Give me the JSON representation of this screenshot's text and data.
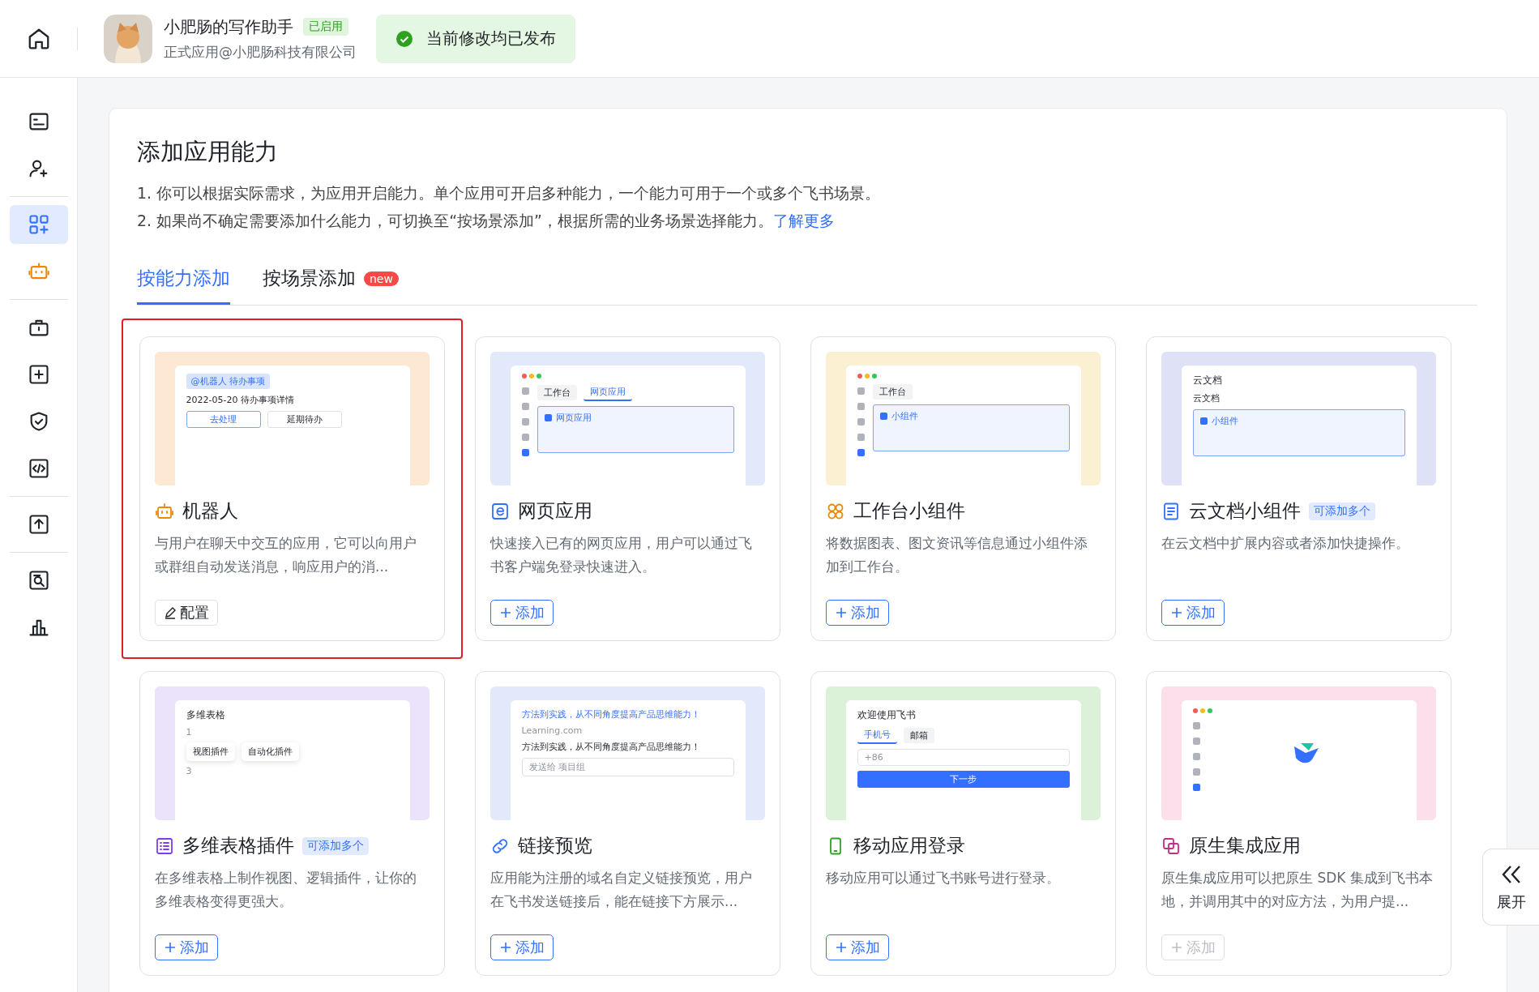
{
  "app": {
    "name": "小肥肠的写作助手",
    "status_badge": "已启用",
    "subtitle": "正式应用@小肥肠科技有限公司",
    "publish_status": "当前修改均已发布"
  },
  "sidebar": {
    "groups": [
      [
        {
          "selected": false
        },
        {
          "selected": false
        }
      ],
      [
        {
          "selected": true
        },
        {
          "selected": false
        }
      ],
      [
        {
          "selected": false
        },
        {
          "selected": false
        },
        {
          "selected": false
        },
        {
          "selected": false
        }
      ],
      [
        {
          "selected": false
        }
      ],
      [
        {
          "selected": false
        },
        {
          "selected": false
        }
      ]
    ]
  },
  "page": {
    "title": "添加应用能力",
    "notes": [
      "1. 你可以根据实际需求，为应用开启能力。单个应用可开启多种能力，一个能力可用于一个或多个飞书场景。",
      "2. 如果尚不确定需要添加什么能力，可切换至“按场景添加”，根据所需的业务场景选择能力。"
    ],
    "learn_more": "了解更多"
  },
  "tabs": [
    {
      "label": "按能力添加",
      "selected": true
    },
    {
      "label": "按场景添加",
      "selected": false,
      "badge": "new"
    }
  ],
  "cards": [
    {
      "title": "机器人",
      "description": "与用户在聊天中交互的应用，它可以向用户或群组自动发送消息，响应用户的消...",
      "selected": true,
      "button": {
        "kind": "config",
        "label": "配置",
        "disabled": false
      },
      "preview": {
        "kind": "chat",
        "rows": [
          [
            {
              "kind": "chip",
              "text": "@机器人  待办事项"
            }
          ],
          [
            {
              "kind": "text",
              "text": "2022-05-20 待办事项详情"
            }
          ],
          [
            {
              "kind": "button",
              "text": "去处理",
              "selected": true
            },
            {
              "kind": "button",
              "text": "延期待办",
              "selected": false
            }
          ]
        ]
      }
    },
    {
      "title": "网页应用",
      "description": "快速接入已有的网页应用，用户可以通过飞书客户端免登录快速进入。",
      "selected": false,
      "button": {
        "kind": "add",
        "label": "添加",
        "disabled": false
      },
      "preview": {
        "kind": "window",
        "rows": [
          [
            {
              "kind": "tab",
              "text": "工作台",
              "selected": false
            },
            {
              "kind": "tab",
              "text": "网页应用",
              "selected": true
            }
          ],
          [
            {
              "kind": "box",
              "text": "网页应用"
            }
          ]
        ]
      }
    },
    {
      "title": "工作台小组件",
      "description": "将数据图表、图文资讯等信息通过小组件添加到工作台。",
      "selected": false,
      "button": {
        "kind": "add",
        "label": "添加",
        "disabled": false
      },
      "preview": {
        "kind": "window",
        "rows": [
          [
            {
              "kind": "tab",
              "text": "工作台",
              "selected": false
            }
          ],
          [
            {
              "kind": "box",
              "text": "小组件"
            }
          ]
        ]
      }
    },
    {
      "title": "云文档小组件",
      "badge": "可添加多个",
      "description": "在云文档中扩展内容或者添加快捷操作。",
      "selected": false,
      "button": {
        "kind": "add",
        "label": "添加",
        "disabled": false
      },
      "preview": {
        "kind": "doc",
        "rows": [
          [
            {
              "kind": "title",
              "text": "云文档"
            }
          ],
          [
            {
              "kind": "text",
              "text": "云文档"
            }
          ],
          [
            {
              "kind": "box",
              "text": "小组件"
            }
          ]
        ]
      }
    },
    {
      "title": "多维表格插件",
      "badge": "可添加多个",
      "description": "在多维表格上制作视图、逻辑插件，让你的多维表格变得更强大。",
      "selected": false,
      "button": {
        "kind": "add",
        "label": "添加",
        "disabled": false
      },
      "preview": {
        "kind": "doc",
        "rows": [
          [
            {
              "kind": "title",
              "text": "多维表格"
            }
          ],
          [
            {
              "kind": "num",
              "text": "1"
            }
          ],
          [
            {
              "kind": "plugin",
              "text": "视图插件"
            },
            {
              "kind": "plugin",
              "text": "自动化插件"
            }
          ],
          [
            {
              "kind": "num",
              "text": "3"
            }
          ]
        ]
      }
    },
    {
      "title": "链接预览",
      "description": "应用能为注册的域名自定义链接预览，用户在飞书发送链接后，能在链接下方展示...",
      "selected": false,
      "button": {
        "kind": "add",
        "label": "添加",
        "disabled": false
      },
      "preview": {
        "kind": "chat",
        "rows": [
          [
            {
              "kind": "link",
              "text": "方法到实践，从不同角度提高产品思维能力！"
            }
          ],
          [
            {
              "kind": "num",
              "text": "Learning.com"
            }
          ],
          [
            {
              "kind": "text",
              "text": "方法到实践，从不同角度提高产品思维能力！"
            }
          ],
          [
            {
              "kind": "input",
              "text": "发送给 项目组"
            }
          ]
        ]
      }
    },
    {
      "title": "移动应用登录",
      "description": "移动应用可以通过飞书账号进行登录。",
      "selected": false,
      "button": {
        "kind": "add",
        "label": "添加",
        "disabled": false
      },
      "preview": {
        "kind": "login",
        "rows": [
          [
            {
              "kind": "title",
              "text": "欢迎使用飞书"
            }
          ],
          [
            {
              "kind": "tab",
              "text": "手机号",
              "selected": true
            },
            {
              "kind": "tab",
              "text": "邮箱",
              "selected": false
            }
          ],
          [
            {
              "kind": "input",
              "text": "+86"
            }
          ],
          [
            {
              "kind": "primary",
              "text": "下一步"
            }
          ]
        ]
      }
    },
    {
      "title": "原生集成应用",
      "description": "原生集成应用可以把原生 SDK 集成到飞书本地，并调用其中的对应方法，为用户提...",
      "selected": false,
      "button": {
        "kind": "add",
        "label": "添加",
        "disabled": true
      },
      "preview": {
        "kind": "logo"
      }
    }
  ],
  "expand": {
    "label": "展开"
  }
}
